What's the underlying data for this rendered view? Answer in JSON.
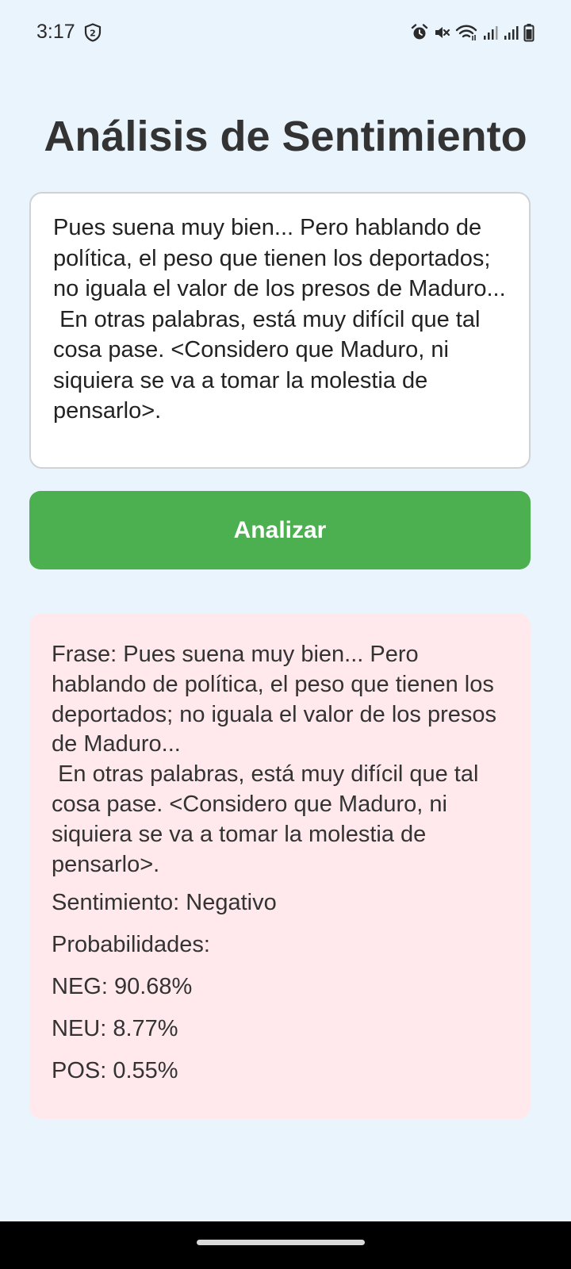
{
  "status_bar": {
    "time": "3:17",
    "left_icon": "shield-2-icon",
    "right_icons": [
      "alarm-icon",
      "mute-icon",
      "wifi-icon",
      "signal-icon",
      "signal-icon",
      "battery-icon"
    ]
  },
  "title": "Análisis de Sentimiento",
  "input": {
    "value": "Pues suena muy bien... Pero hablando de política, el peso que tienen los deportados; no iguala el valor de los presos de Maduro...\n En otras palabras, está muy difícil que tal cosa pase. <Considero que Maduro, ni siquiera se va a tomar la molestia de pensarlo>."
  },
  "analyze_button": {
    "label": "Analizar",
    "color": "#4CAF50"
  },
  "result": {
    "phrase": "Frase: Pues suena muy bien... Pero hablando de política, el peso que tienen los deportados; no iguala el valor de los presos de Maduro...\n En otras palabras, está muy difícil que tal cosa pase. <Considero que Maduro, ni siquiera se va a tomar la molestia de pensarlo>.",
    "sentiment": "Sentimiento: Negativo",
    "probabilities_label": "Probabilidades:",
    "neg": "NEG: 90.68%",
    "neu": "NEU: 8.77%",
    "pos": "POS: 0.55%",
    "background": "#FFE9EC"
  },
  "colors": {
    "page_background": "#EAF4FD",
    "text": "#333333"
  }
}
